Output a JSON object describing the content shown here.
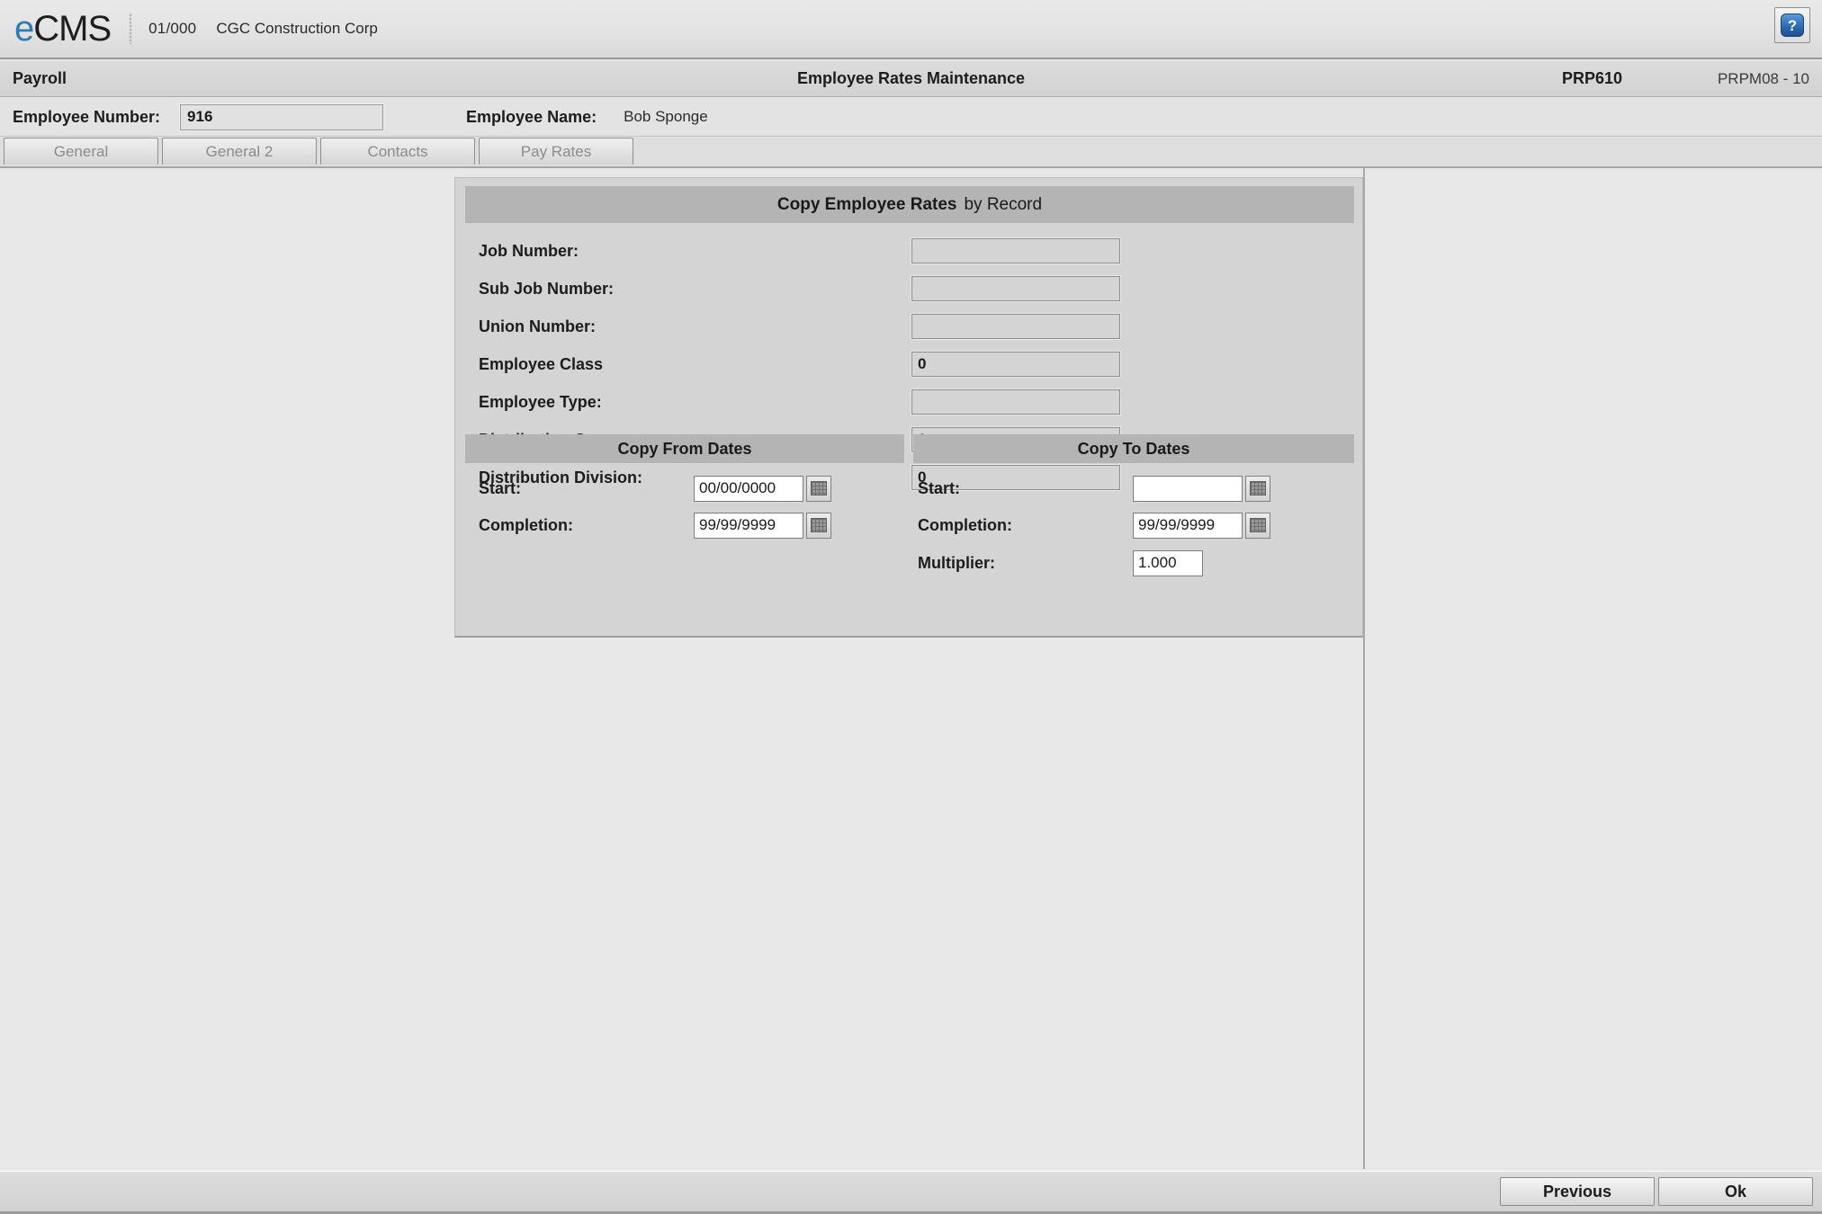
{
  "brand": {
    "logo_prefix": "e",
    "logo_suffix": "CMS",
    "company_code": "01/000",
    "company_name": "CGC Construction Corp",
    "help_glyph": "?",
    "accent_color": "#2e7cb0"
  },
  "modulebar": {
    "module": "Payroll",
    "screen_title": "Employee Rates Maintenance",
    "program_id": "PRP610",
    "program_sub": "PRPM08 - 10"
  },
  "employee": {
    "number_label": "Employee Number:",
    "number_value": "916",
    "number_placeholder": "",
    "name_label": "Employee Name:",
    "name_value": "Bob Sponge"
  },
  "tabs": [
    {
      "label": "General"
    },
    {
      "label": "General 2"
    },
    {
      "label": "Contacts"
    },
    {
      "label": "Pay Rates"
    }
  ],
  "panel": {
    "title_strong": "Copy Employee Rates",
    "title_weak": "by Record",
    "fields": [
      {
        "label": "Job Number:",
        "value": ""
      },
      {
        "label": "Sub Job Number:",
        "value": ""
      },
      {
        "label": "Union Number:",
        "value": ""
      },
      {
        "label": "Employee Class",
        "value": "0"
      },
      {
        "label": "Employee Type:",
        "value": ""
      },
      {
        "label": "Distribution Company:",
        "value": "1"
      },
      {
        "label": "Distribution Division:",
        "value": "0"
      }
    ],
    "copy_from": {
      "header": "Copy From Dates",
      "start_label": "Start:",
      "start_value": "00/00/0000",
      "completion_label": "Completion:",
      "completion_value": "99/99/9999",
      "calendar_icon": "calendar-icon"
    },
    "copy_to": {
      "header": "Copy To Dates",
      "start_label": "Start:",
      "start_value": "",
      "completion_label": "Completion:",
      "completion_value": "99/99/9999",
      "multiplier_label": "Multiplier:",
      "multiplier_value": "1.000",
      "calendar_icon": "calendar-icon"
    }
  },
  "footer": {
    "previous_label": "Previous",
    "ok_label": "Ok"
  }
}
